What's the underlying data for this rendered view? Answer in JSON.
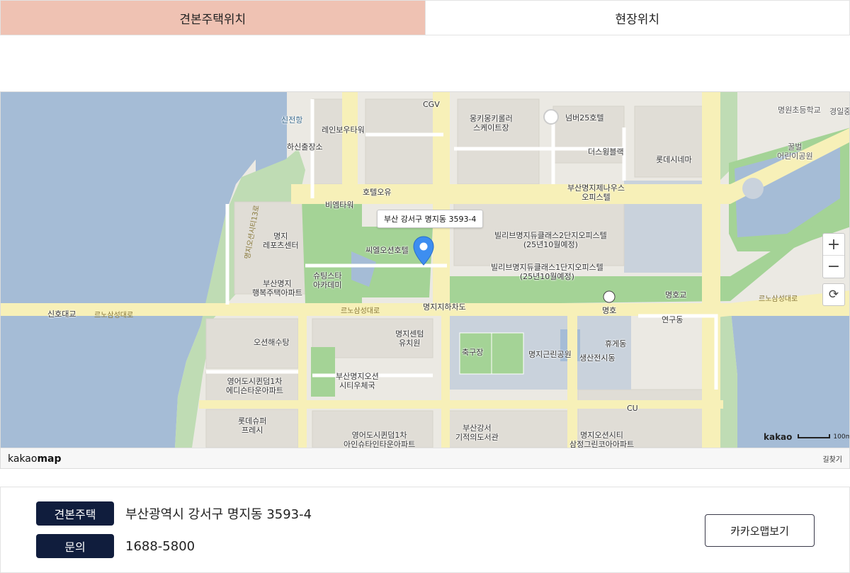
{
  "tabs": [
    {
      "label": "견본주택위치",
      "active": true
    },
    {
      "label": "현장위치",
      "active": false
    }
  ],
  "map": {
    "callout_text": "부산 강서구 명지동 3593-4",
    "footer_logo_light": "kakao",
    "footer_logo_bold": "map",
    "directions_label": "길찾기",
    "scale_brand": "kakao",
    "scale_distance": "100m",
    "zoom_in_label": "+",
    "zoom_out_label": "−",
    "reset_label": "⟳",
    "colors": {
      "water": "#a5bcd6",
      "land": "#ebe9e3",
      "park": "#a4d396",
      "road": "#f7f0b8",
      "block": "#e0ddd6"
    },
    "pois": [
      {
        "id": "sinjeonhang",
        "text": "신전항"
      },
      {
        "id": "hasinchuljangso",
        "text": "하신출장소"
      },
      {
        "id": "rainbow",
        "text": "레인보우타워"
      },
      {
        "id": "cgv",
        "text": "CGV"
      },
      {
        "id": "monkey",
        "text": "몽키몽키롤러\n스케이트장"
      },
      {
        "id": "number25",
        "text": "넘버25호텔"
      },
      {
        "id": "thewing",
        "text": "더스윙블랙"
      },
      {
        "id": "lotte-cinema",
        "text": "롯데시네마"
      },
      {
        "id": "myeongwon",
        "text": "명원초등학교"
      },
      {
        "id": "gyeongil",
        "text": "경일중"
      },
      {
        "id": "kkulbeol",
        "text": "꿀벌\n어린이공원"
      },
      {
        "id": "hotel-ou",
        "text": "호텔오유"
      },
      {
        "id": "bm-tower",
        "text": "비엠타워"
      },
      {
        "id": "jenaus",
        "text": "부산명지제나우스\n오피스텔"
      },
      {
        "id": "billy2",
        "text": "빌리브명지듀클래스2단지오피스텔\n(25년10월예정)"
      },
      {
        "id": "billy1",
        "text": "빌리브명지듀클래스1단지오피스텔\n(25년10월예정)"
      },
      {
        "id": "sports",
        "text": "명지\n레포츠센터"
      },
      {
        "id": "seawell",
        "text": "씨엘오션호텔"
      },
      {
        "id": "shooting",
        "text": "슈팅스타\n아카데미"
      },
      {
        "id": "happy",
        "text": "부산명지\n행복주택아파트"
      },
      {
        "id": "sinho",
        "text": "신호대교"
      },
      {
        "id": "myeongho-ic",
        "text": "명호"
      },
      {
        "id": "myeongho-gyo",
        "text": "명호교"
      },
      {
        "id": "underpass",
        "text": "명지지하차도"
      },
      {
        "id": "ocean-bath",
        "text": "오션해수탕"
      },
      {
        "id": "kinder",
        "text": "명지센텀\n유치원"
      },
      {
        "id": "yeongeo1",
        "text": "영어도시퀸덤1차\n에디슨타운아파트"
      },
      {
        "id": "gym",
        "text": "부산명지오션\n시티우체국"
      },
      {
        "id": "soccer",
        "text": "축구장"
      },
      {
        "id": "park",
        "text": "명지근린공원"
      },
      {
        "id": "yeongu",
        "text": "연구동"
      },
      {
        "id": "hugye",
        "text": "휴게동"
      },
      {
        "id": "saengsan",
        "text": "생산전시동"
      },
      {
        "id": "cu",
        "text": "CU"
      },
      {
        "id": "lotte-fresh",
        "text": "롯데슈퍼\n프레시"
      },
      {
        "id": "yeongeo2",
        "text": "영어도시퀸덤1차\n아인슈타인타운아파트"
      },
      {
        "id": "library",
        "text": "부산강서\n기적의도서관"
      },
      {
        "id": "ocean-city",
        "text": "명지오션시티\n삼정그린코아아파트"
      }
    ],
    "road_labels": [
      {
        "id": "r-left",
        "text": "르노삼성대로"
      },
      {
        "id": "r-mid",
        "text": "르노삼성대로"
      },
      {
        "id": "r-right",
        "text": "르노삼성대로"
      },
      {
        "id": "r-vert",
        "text": "명지오션시티13로"
      }
    ]
  },
  "info": {
    "model_house_label": "견본주택",
    "model_house_address": "부산광역시 강서구 명지동 3593-4",
    "inquiry_label": "문의",
    "inquiry_phone": "1688-5800",
    "kakao_button_label": "카카오맵보기"
  }
}
